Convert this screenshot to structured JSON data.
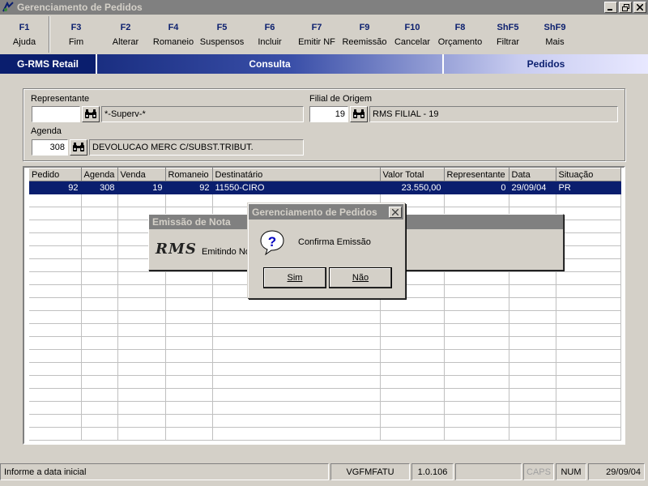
{
  "window": {
    "title": "Gerenciamento de Pedidos",
    "controls": [
      "_",
      "□",
      "×"
    ]
  },
  "fkeys": [
    {
      "key": "F1",
      "label": "Ajuda"
    },
    {
      "key": "F3",
      "label": "Fim"
    },
    {
      "key": "F2",
      "label": "Alterar"
    },
    {
      "key": "F4",
      "label": "Romaneio"
    },
    {
      "key": "F5",
      "label": "Suspensos"
    },
    {
      "key": "F6",
      "label": "Incluir"
    },
    {
      "key": "F7",
      "label": "Emitir NF"
    },
    {
      "key": "F9",
      "label": "Reemissão"
    },
    {
      "key": "F10",
      "label": "Cancelar"
    },
    {
      "key": "F8",
      "label": "Orçamento"
    },
    {
      "key": "ShF5",
      "label": "Filtrar"
    },
    {
      "key": "ShF9",
      "label": "Mais"
    }
  ],
  "banner": {
    "app": "G-RMS Retail",
    "mode": "Consulta",
    "module": "Pedidos"
  },
  "filters": {
    "representante_label": "Representante",
    "representante_value": "",
    "representante_desc": "*-Superv-*",
    "filial_label": "Filial de Origem",
    "filial_value": "19",
    "filial_desc": "RMS FILIAL - 19",
    "agenda_label": "Agenda",
    "agenda_value": "308",
    "agenda_desc": "DEVOLUCAO MERC C/SUBST.TRIBUT."
  },
  "grid": {
    "columns": [
      "Pedido",
      "Agenda",
      "Venda",
      "Romaneio",
      "Destinatário",
      "Valor Total",
      "Representante",
      "Data",
      "Situação"
    ],
    "rows": [
      [
        "92",
        "308",
        "19",
        "92",
        "11550-CIRO",
        "23.550,00",
        "0",
        "29/09/04",
        "PR"
      ]
    ],
    "empty_rows": 19
  },
  "dialog_back": {
    "title": "Emissão de Nota",
    "logo": "RMS",
    "message": "Emitindo Nota"
  },
  "dialog": {
    "title": "Gerenciamento de Pedidos",
    "message": "Confirma Emissão",
    "yes_label": "Sim",
    "no_label": "Não"
  },
  "statusbar": {
    "message": "Informe a data inicial",
    "program": "VGFMFATU",
    "version": "1.0.106",
    "caps": "CAPS",
    "num": "NUM",
    "date": "29/09/04"
  },
  "colors": {
    "accent": "#0a1e6e",
    "face": "#d4d0c8",
    "inactive_caption": "#808080"
  }
}
